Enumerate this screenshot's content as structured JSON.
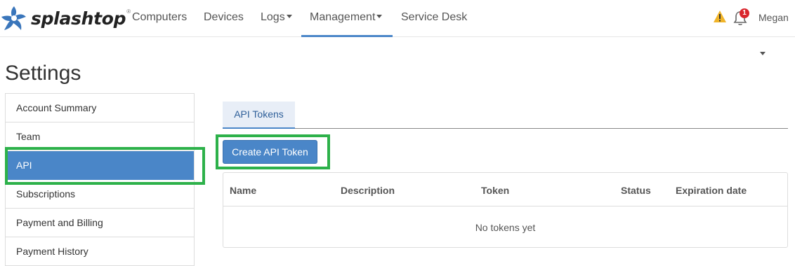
{
  "brand": {
    "name": "splashtop",
    "reg": "®"
  },
  "nav": {
    "computers": "Computers",
    "devices": "Devices",
    "logs": "Logs",
    "management": "Management",
    "service_desk": "Service Desk"
  },
  "header": {
    "notification_count": "1",
    "user_name": "Megan",
    "icons": [
      "warning-icon",
      "bell-icon",
      "caret-down-icon"
    ]
  },
  "page": {
    "title": "Settings"
  },
  "sidebar": {
    "items": [
      {
        "label": "Account Summary"
      },
      {
        "label": "Team"
      },
      {
        "label": "API"
      },
      {
        "label": "Subscriptions"
      },
      {
        "label": "Payment and Billing"
      },
      {
        "label": "Payment History"
      }
    ],
    "active": "API"
  },
  "tabs": {
    "api_tokens": "API Tokens"
  },
  "actions": {
    "create_token": "Create API Token"
  },
  "table": {
    "columns": [
      "Name",
      "Description",
      "Token",
      "Status",
      "Expiration date"
    ],
    "empty_text": "No tokens yet"
  },
  "colors": {
    "accent": "#4a86c8",
    "highlight": "#2db14a",
    "badge": "#d9262d",
    "warning": "#f0b429"
  }
}
